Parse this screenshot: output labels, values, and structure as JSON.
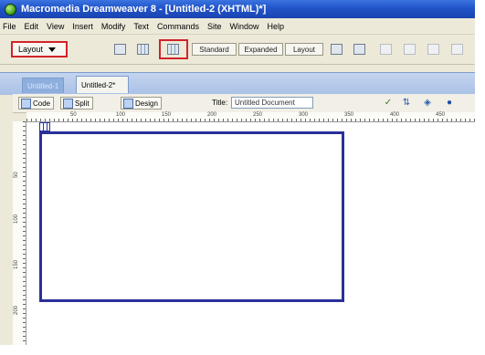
{
  "window": {
    "title": "Macromedia Dreamweaver 8 - [Untitled-2 (XHTML)*]"
  },
  "menu": [
    "File",
    "Edit",
    "View",
    "Insert",
    "Modify",
    "Text",
    "Commands",
    "Site",
    "Window",
    "Help"
  ],
  "insert_bar": {
    "category": "Layout",
    "mode_buttons": [
      "Standard",
      "Expanded",
      "Layout"
    ]
  },
  "tabs": [
    {
      "label": "Untitled-1",
      "active": false
    },
    {
      "label": "Untitled-2*",
      "active": true
    }
  ],
  "document_toolbar": {
    "code_label": "Code",
    "split_label": "Split",
    "design_label": "Design",
    "title_label": "Title:",
    "title_value": "Untitled Document"
  },
  "ruler": {
    "h_ticks": [
      "50",
      "100",
      "150",
      "200",
      "250",
      "300",
      "350",
      "400",
      "450"
    ],
    "v_ticks": [
      "50",
      "100",
      "150",
      "200"
    ]
  },
  "colors": {
    "accent_red": "#d2232a",
    "table_border": "#2a2f9a",
    "titlebar": "#2154c8"
  }
}
